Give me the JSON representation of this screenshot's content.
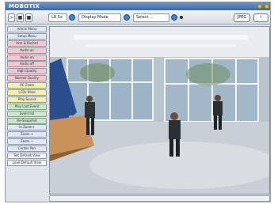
{
  "titlebar": {
    "brand": "MOBOTIX"
  },
  "toolbar": {
    "buttons": [
      ">",
      "■",
      "■"
    ],
    "size_select": "LR 5x",
    "mode_select": "Display Mode",
    "event_select": "Select ...",
    "jpeg_button": "JPEG",
    "info_button": "i"
  },
  "sidebar": {
    "items": [
      "Admin Menu",
      "Setup Menu",
      "Arm & Record",
      "Audio on",
      "Audio on",
      "Audio off",
      "High Quality",
      "Normal Quality",
      "UC Zoom",
      "LCDs Blink",
      "Play Sound",
      "Play Last Event",
      "Event list",
      "Re-Snapshot",
      "In Zoom+",
      "Zoom +",
      "Zoom −",
      "Center Pan",
      "Set Default View",
      "Load Default View"
    ]
  },
  "colors": {
    "titlebar": "#4a73ae",
    "sidebar_blue": "#dfe8f6",
    "sidebar_pink": "#f4c6cf",
    "sidebar_yellow": "#f6f0a9",
    "sidebar_green": "#c8eac0"
  }
}
